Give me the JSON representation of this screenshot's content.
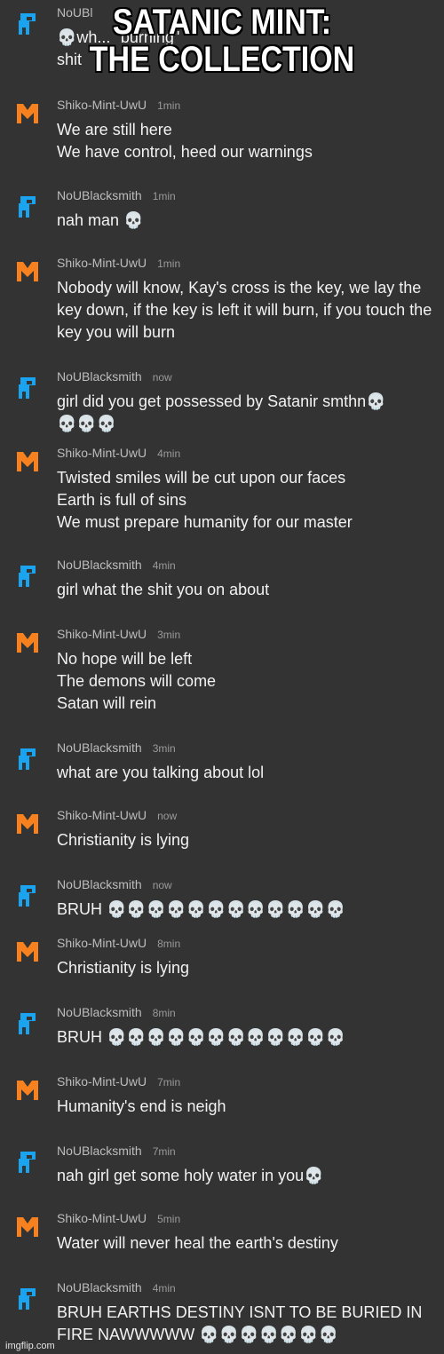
{
  "meme": {
    "caption_line1": "SATANIC MINT:",
    "caption_line2": "THE COLLECTION",
    "watermark": "imgflip.com"
  },
  "colors": {
    "background": "#333333",
    "blue_avatar": "#1aa3ee",
    "orange_avatar": "#f7811e"
  },
  "messages": [
    {
      "author": "NoUBl",
      "time": "",
      "avatar": "blue-blob-icon",
      "text": "💀wh... \"burning\"\nshit"
    },
    {
      "author": "Shiko-Mint-UwU",
      "time": "1min",
      "avatar": "orange-m-icon",
      "text": "We are still here\nWe have control, heed our warnings"
    },
    {
      "author": "NoUBlacksmith",
      "time": "1min",
      "avatar": "blue-blob-icon",
      "text": "nah man 💀"
    },
    {
      "author": "Shiko-Mint-UwU",
      "time": "1min",
      "avatar": "orange-m-icon",
      "text": "Nobody will know, Kay's cross is the key, we lay the key down, if the key is left it will burn, if you touch the key you will burn"
    },
    {
      "author": "NoUBlacksmith",
      "time": "now",
      "avatar": "blue-blob-icon",
      "text": "girl did you get possessed by Satanir smthn💀\n💀💀💀"
    },
    {
      "author": "Shiko-Mint-UwU",
      "time": "4min",
      "avatar": "orange-m-icon",
      "text": "Twisted smiles will be cut upon our faces\nEarth is full of sins\nWe must prepare humanity for our master"
    },
    {
      "author": "NoUBlacksmith",
      "time": "4min",
      "avatar": "blue-blob-icon",
      "text": "girl what the shit you on about"
    },
    {
      "author": "Shiko-Mint-UwU",
      "time": "3min",
      "avatar": "orange-m-icon",
      "text": "No hope will be left\nThe demons will come\nSatan will rein"
    },
    {
      "author": "NoUBlacksmith",
      "time": "3min",
      "avatar": "blue-blob-icon",
      "text": "what are you talking about lol"
    },
    {
      "author": "Shiko-Mint-UwU",
      "time": "now",
      "avatar": "orange-m-icon",
      "text": "Christianity is lying"
    },
    {
      "author": "NoUBlacksmith",
      "time": "now",
      "avatar": "blue-blob-icon",
      "text": "BRUH 💀💀💀💀💀💀💀💀💀💀💀💀"
    },
    {
      "author": "Shiko-Mint-UwU",
      "time": "8min",
      "avatar": "orange-m-icon",
      "text": "Christianity is lying"
    },
    {
      "author": "NoUBlacksmith",
      "time": "8min",
      "avatar": "blue-blob-icon",
      "text": "BRUH 💀💀💀💀💀💀💀💀💀💀💀💀"
    },
    {
      "author": "Shiko-Mint-UwU",
      "time": "7min",
      "avatar": "orange-m-icon",
      "text": "Humanity's end is neigh"
    },
    {
      "author": "NoUBlacksmith",
      "time": "7min",
      "avatar": "blue-blob-icon",
      "text": "nah girl get some holy water in you💀"
    },
    {
      "author": "Shiko-Mint-UwU",
      "time": "5min",
      "avatar": "orange-m-icon",
      "text": "Water will never heal the earth's destiny"
    },
    {
      "author": "NoUBlacksmith",
      "time": "4min",
      "avatar": "blue-blob-icon",
      "text": "BRUH EARTHS DESTINY ISNT TO BE BURIED IN FIRE NAWWWWW 💀💀💀💀💀💀💀"
    }
  ]
}
